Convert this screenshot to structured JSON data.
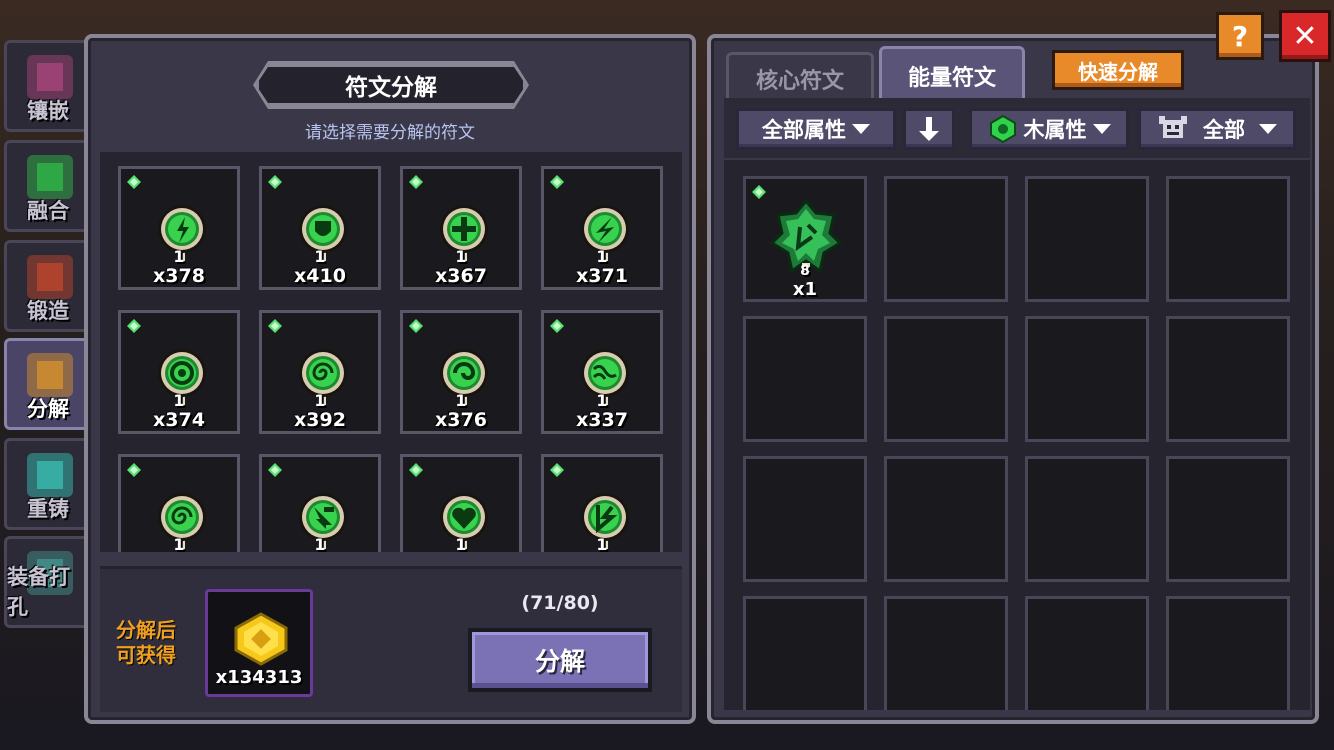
{
  "side_nav": [
    {
      "label": "镶嵌",
      "active": false
    },
    {
      "label": "融合",
      "active": false
    },
    {
      "label": "锻造",
      "active": false
    },
    {
      "label": "分解",
      "active": true
    },
    {
      "label": "重铸",
      "active": false
    },
    {
      "label": "装备打孔",
      "active": false
    }
  ],
  "left": {
    "title": "符文分解",
    "subtitle": "请选择需要分解的符文",
    "runes": [
      {
        "level": "1",
        "count": "x378",
        "icon": "bolt-rune"
      },
      {
        "level": "1",
        "count": "x410",
        "icon": "shield-rune"
      },
      {
        "level": "1",
        "count": "x367",
        "icon": "cross-rune"
      },
      {
        "level": "1",
        "count": "x371",
        "icon": "lightning-rune"
      },
      {
        "level": "1",
        "count": "x374",
        "icon": "circle-rune"
      },
      {
        "level": "1",
        "count": "x392",
        "icon": "spiral-rune"
      },
      {
        "level": "1",
        "count": "x376",
        "icon": "swirl-rune"
      },
      {
        "level": "1",
        "count": "x337",
        "icon": "wave-rune"
      },
      {
        "level": "1",
        "count": "",
        "icon": "spiral-rune"
      },
      {
        "level": "1",
        "count": "",
        "icon": "arrow-rune"
      },
      {
        "level": "1",
        "count": "",
        "icon": "heart-rune"
      },
      {
        "level": "1",
        "count": "",
        "icon": "leaf-rune"
      }
    ],
    "reward_label": "分解后可获得",
    "reward_amount": "x134313",
    "capacity": "(71/80)",
    "decompose_button": "分解"
  },
  "right": {
    "tabs": {
      "core": "核心符文",
      "energy": "能量符文"
    },
    "quick_button": "快速分解",
    "filters": {
      "attribute_all": "全部属性",
      "wood": "木属性",
      "all": "全部"
    },
    "inventory": [
      {
        "level": "8",
        "count": "x1",
        "icon": "wood-core-rune"
      }
    ]
  },
  "help_label": "?",
  "close_label": "✕",
  "colors": {
    "accent_green": "#2fd24a",
    "panel": "#3a3848",
    "orange": "#e88a2a",
    "red": "#d8282a"
  }
}
